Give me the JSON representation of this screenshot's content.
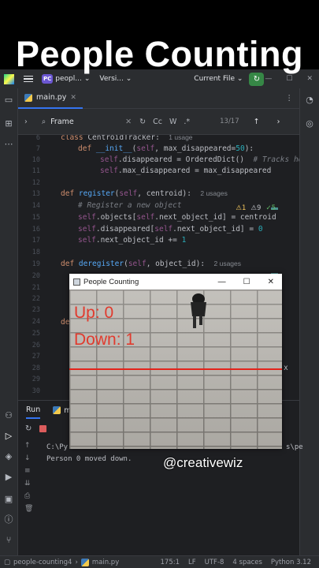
{
  "overlay": {
    "title": "People Counting",
    "watermark": "@creativewiz"
  },
  "titlebar": {
    "project_badge": "PC",
    "project_name": "peopl...",
    "vcs_label": "Versi...",
    "run_config": "Current File",
    "chevron": "⌄"
  },
  "tabs": [
    {
      "label": "main.py"
    }
  ],
  "findbar": {
    "query": "Frame",
    "match_case": "Cc",
    "words": "W",
    "regex": ".*",
    "count": "13/17"
  },
  "inspections": {
    "warnings": "1",
    "weak": "9",
    "ok": "5"
  },
  "editor": {
    "lines": [
      {
        "n": "6",
        "code": "class CentroidTracker:",
        "hint": "1 usage"
      },
      {
        "n": "7",
        "code": "def __init__(self, max_disappeared=50):"
      },
      {
        "n": "10",
        "code": "self.disappeared = OrderedDict()",
        "comment": "# Tracks how long"
      },
      {
        "n": "11",
        "code": "self.max_disappeared = max_disappeared"
      },
      {
        "n": "12",
        "code": ""
      },
      {
        "n": "13",
        "code": "def register(self, centroid):",
        "hint": "2 usages"
      },
      {
        "n": "14",
        "code": "# Register a new object"
      },
      {
        "n": "15",
        "code": "self.objects[self.next_object_id] = centroid"
      },
      {
        "n": "16",
        "code": "self.disappeared[self.next_object_id] = 0"
      },
      {
        "n": "17",
        "code": "self.next_object_id += 1"
      },
      {
        "n": "18",
        "code": ""
      },
      {
        "n": "19",
        "code": "def deregister(self, object_id):",
        "hint": "2 usages"
      },
      {
        "n": "20",
        "code": ""
      },
      {
        "n": "21",
        "code": ""
      },
      {
        "n": "22",
        "code": ""
      },
      {
        "n": "23",
        "code": ""
      },
      {
        "n": "24",
        "code": "de"
      },
      {
        "n": "25",
        "code": ""
      },
      {
        "n": "26",
        "code": ""
      },
      {
        "n": "27",
        "code": ""
      },
      {
        "n": "28",
        "code": ""
      },
      {
        "n": "29",
        "code": ""
      },
      {
        "n": "30",
        "code": ""
      }
    ],
    "tail_24": "):",
    "tail_28": "x"
  },
  "run_panel": {
    "tab": "Run",
    "sub_tab": "m",
    "console": [
      "C:\\Py",
      "Person 0 moved down."
    ],
    "console_tail": "s\\pe"
  },
  "cv_window": {
    "title": "People Counting",
    "up_text": "Up: 0",
    "down_text": "Down: 1",
    "up_count": 0,
    "down_count": 1
  },
  "statusbar": {
    "project": "people-counting4",
    "file": "main.py",
    "position": "175:1",
    "line_sep": "LF",
    "encoding": "UTF-8",
    "indent": "4 spaces",
    "interpreter": "Python 3.12"
  },
  "colors": {
    "accent": "#3574f0",
    "run_green": "#368746",
    "overlay_text_red": "#e13b2e"
  }
}
